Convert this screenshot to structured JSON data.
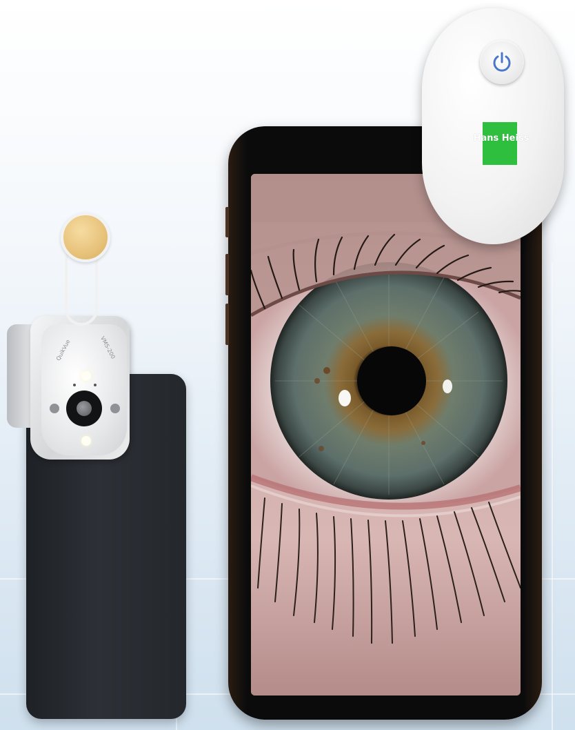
{
  "scene": {
    "background_color": "#dfeaf4",
    "accent_colors": {
      "logo_green": "#2fbf3f",
      "power_icon_blue": "#4a78c8",
      "filter_amber": "#e7c27a",
      "iris_green_gray": "#6f7d6c",
      "phone_frame_gold": "#2a1c12"
    }
  },
  "left_device": {
    "lens_label_left": "QuikVue",
    "lens_label_right": "VMS-200",
    "icons": [
      "clip-on-lens-icon",
      "filter-disc-icon"
    ]
  },
  "light_module": {
    "brand_name": "Hans Heiss",
    "icons": [
      "power-icon"
    ]
  },
  "phone_screen": {
    "content": "eye-closeup"
  }
}
